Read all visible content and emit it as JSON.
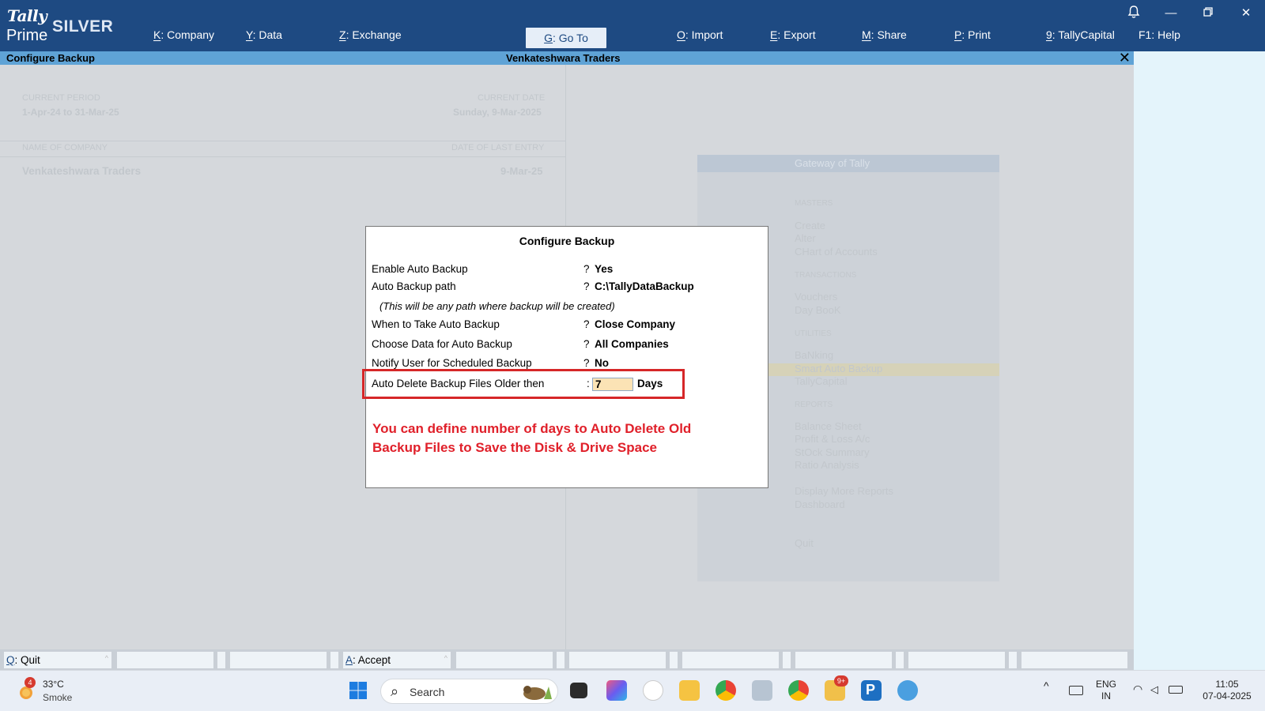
{
  "app": {
    "brand_top": "Tally",
    "brand_bottom": "Prime",
    "edition": "SILVER"
  },
  "menu": [
    {
      "key": "K",
      "label": "Company"
    },
    {
      "key": "Y",
      "label": "Data"
    },
    {
      "key": "Z",
      "label": "Exchange"
    },
    {
      "key": "G",
      "label": "Go To"
    },
    {
      "key": "O",
      "label": "Import"
    },
    {
      "key": "E",
      "label": "Export"
    },
    {
      "key": "M",
      "label": "Share"
    },
    {
      "key": "P",
      "label": "Print"
    },
    {
      "key": "9",
      "label": "TallyCapital"
    },
    {
      "key": "F1",
      "label": "Help"
    }
  ],
  "titlebar": {
    "screen": "Configure Backup",
    "company": "Venkateshwara Traders",
    "close": "✕"
  },
  "background": {
    "current_period_label": "CURRENT PERIOD",
    "current_period_value": "1-Apr-24 to 31-Mar-25",
    "current_date_label": "CURRENT DATE",
    "current_date_value": "Sunday, 9-Mar-2025",
    "name_of_company_label": "NAME OF COMPANY",
    "date_last_entry_label": "DATE OF LAST ENTRY",
    "company_name": "Venkateshwara Traders",
    "last_entry": "9-Mar-25",
    "gateway": {
      "title": "Gateway of Tally",
      "sections": [
        {
          "heading": "MASTERS",
          "items": [
            "Create",
            "Alter",
            "CHart of Accounts"
          ]
        },
        {
          "heading": "TRANSACTIONS",
          "items": [
            "Vouchers",
            "Day BooK"
          ]
        },
        {
          "heading": "UTILITIES",
          "items": [
            "BaNking",
            "Smart Auto Backup",
            "TallyCapital"
          ]
        },
        {
          "heading": "REPORTS",
          "items": [
            "Balance Sheet",
            "Profit & Loss A/c",
            "StOck Summary",
            "Ratio Analysis"
          ]
        }
      ],
      "extra": [
        "Display More Reports",
        "Dashboard"
      ],
      "quit": "Quit"
    }
  },
  "dialog": {
    "title": "Configure Backup",
    "rows": [
      {
        "label": "Enable Auto Backup",
        "sep": "?",
        "value": "Yes"
      },
      {
        "label": "Auto Backup path",
        "sep": "?",
        "value": "C:\\TallyDataBackup"
      },
      {
        "label": "When to Take Auto Backup",
        "sep": "?",
        "value": "Close Company"
      },
      {
        "label": "Choose Data for Auto Backup",
        "sep": "?",
        "value": "All Companies"
      },
      {
        "label": "Notify User for Scheduled Backup",
        "sep": "?",
        "value": "No"
      }
    ],
    "path_note": "(This will be any path where backup will be created)",
    "auto_delete": {
      "label": "Auto Delete Backup Files Older then",
      "sep": ":",
      "value": "7",
      "unit": "Days"
    },
    "annotation_line1": "You can define number of days to Auto Delete Old",
    "annotation_line2": "Backup Files to Save the Disk & Drive Space",
    "annotation_color": "#e0202a"
  },
  "buttons": {
    "quit_key": "Q",
    "quit_label": "Quit",
    "accept_key": "A",
    "accept_label": "Accept"
  },
  "taskbar": {
    "weather_badge": "4",
    "temperature": "33°C",
    "weather_desc": "Smoke",
    "search_placeholder": "Search",
    "mail_badge": "9+",
    "language_line1": "ENG",
    "language_line2": "IN",
    "time": "11:05",
    "date": "07-04-2025"
  },
  "colors": {
    "header_bg": "#1e4a82",
    "titlebar_bg": "#5fa3d6",
    "highlight_box": "#d62728",
    "input_bg": "#fbe3b5"
  }
}
